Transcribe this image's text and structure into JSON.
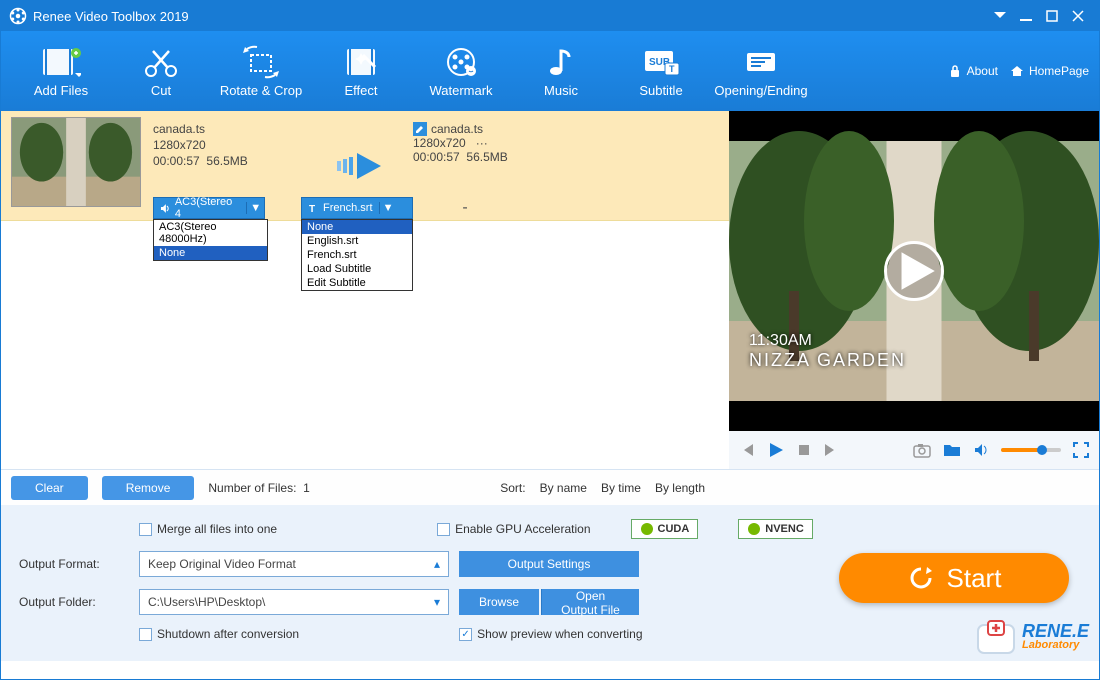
{
  "title": "Renee Video Toolbox 2019",
  "toolbar": [
    {
      "id": "add-files",
      "label": "Add Files"
    },
    {
      "id": "cut",
      "label": "Cut"
    },
    {
      "id": "rotate-crop",
      "label": "Rotate & Crop"
    },
    {
      "id": "effect",
      "label": "Effect"
    },
    {
      "id": "watermark",
      "label": "Watermark"
    },
    {
      "id": "music",
      "label": "Music"
    },
    {
      "id": "subtitle",
      "label": "Subtitle"
    },
    {
      "id": "opening-ending",
      "label": "Opening/Ending"
    }
  ],
  "links": {
    "about": "About",
    "homepage": "HomePage"
  },
  "file": {
    "src": {
      "name": "canada.ts",
      "res": "1280x720",
      "dur": "00:00:57",
      "size": "56.5MB"
    },
    "out": {
      "name": "canada.ts",
      "res": "1280x720",
      "dots": "···",
      "dur": "00:00:57",
      "size": "56.5MB"
    },
    "dash": "-"
  },
  "audioPill": "AC3(Stereo 4",
  "audioOptions": [
    "AC3(Stereo 48000Hz)",
    "None"
  ],
  "audioSelected": "None",
  "subPill": "French.srt",
  "subOptions": [
    "None",
    "English.srt",
    "French.srt",
    "Load Subtitle",
    "Edit Subtitle"
  ],
  "subSelected": "None",
  "preview": {
    "time": "11:30AM",
    "place": "NIZZA GARDEN"
  },
  "actions": {
    "clear": "Clear",
    "remove": "Remove",
    "count_label": "Number of Files:",
    "count": "1",
    "sort": "Sort:",
    "by_name": "By name",
    "by_time": "By time",
    "by_length": "By length"
  },
  "checks": {
    "merge": "Merge all files into one",
    "gpu": "Enable GPU Acceleration",
    "shutdown": "Shutdown after conversion",
    "preview": "Show preview when converting"
  },
  "badges": {
    "cuda": "CUDA",
    "nvenc": "NVENC"
  },
  "output": {
    "format_label": "Output Format:",
    "format_value": "Keep Original Video Format",
    "folder_label": "Output Folder:",
    "folder_value": "C:\\Users\\HP\\Desktop\\",
    "settings": "Output Settings",
    "browse": "Browse",
    "open": "Open Output File"
  },
  "start": "Start",
  "brand": {
    "name": "RENE.E",
    "sub": "Laboratory"
  }
}
